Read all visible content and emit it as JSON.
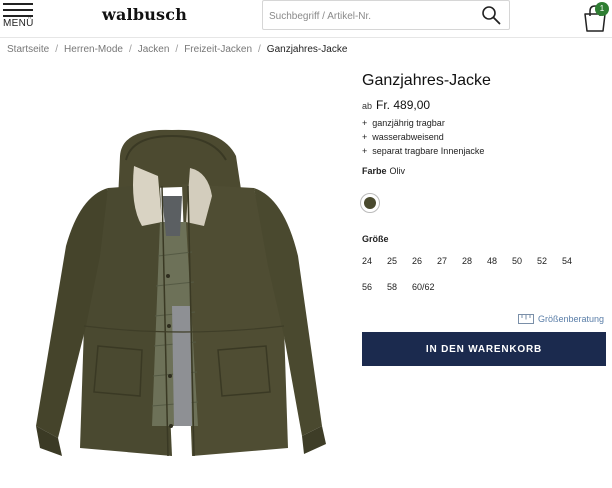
{
  "colors": {
    "navy": "#1b2a4e",
    "olive": "#4a4a2e",
    "badge": "#2e7d32",
    "link": "#5a7ea8"
  },
  "header": {
    "menu_label": "MENÜ",
    "logo_text": "walbusch",
    "search": {
      "placeholder": "Suchbegriff / Artikel-Nr.",
      "value": ""
    },
    "cart_count": "1",
    "icons": [
      "hamburger-menu-icon",
      "search-icon",
      "shopping-bag-icon"
    ]
  },
  "breadcrumb": [
    {
      "label": "Startseite"
    },
    {
      "label": "Herren-Mode"
    },
    {
      "label": "Jacken"
    },
    {
      "label": "Freizeit-Jacken"
    },
    {
      "label": "Ganzjahres-Jacke"
    }
  ],
  "product": {
    "title": "Ganzjahres-Jacke",
    "price_prefix": "ab",
    "price": "Fr. 489,00",
    "features": [
      "ganzjährig tragbar",
      "wasserabweisend",
      "separat tragbare Innenjacke"
    ],
    "color_label": "Farbe",
    "color_value": "Oliv",
    "size_label": "Größe",
    "sizes_row1": [
      "24",
      "25",
      "26",
      "27",
      "28",
      "48",
      "50",
      "52",
      "54"
    ],
    "sizes_row2": [
      "56",
      "58",
      "60/62"
    ],
    "size_guide": "Größenberatung",
    "add_to_cart": "IN DEN WARENKORB"
  }
}
